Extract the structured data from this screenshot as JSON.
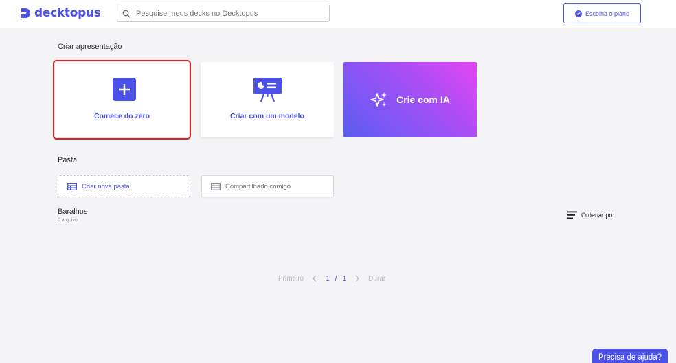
{
  "header": {
    "logo_text": "decktopus",
    "search_placeholder": "Pesquise meus decks no Decktopus",
    "plan_button_label": "Escolha o plano"
  },
  "create": {
    "title": "Criar apresentação",
    "cards": [
      {
        "label": "Comece do zero"
      },
      {
        "label": "Criar com um modelo"
      },
      {
        "label": "Crie com IA"
      }
    ]
  },
  "folders": {
    "title": "Pasta",
    "new_folder_label": "Criar nova pasta",
    "shared_label": "Compartilhado comigo"
  },
  "decks": {
    "title": "Baralhos",
    "count_label": "0 arquivo",
    "sort_label": "Ordenar por"
  },
  "pagination": {
    "first_label": "Primeiro",
    "current_page": "1",
    "separator": "/",
    "total_pages": "1",
    "last_label": "Durar"
  },
  "help_label": "Precisa de ajuda?",
  "colors": {
    "accent": "#4b52e5",
    "background": "#f4f4f7",
    "selection": "#d62828",
    "ai_gradient_start": "#5a5df2",
    "ai_gradient_end": "#e145f0"
  },
  "icons": [
    "logo-mark-icon",
    "search-icon",
    "check-circle-icon",
    "plus-icon",
    "presentation-board-icon",
    "sparkle-icon",
    "folder-list-icon",
    "sort-lines-icon",
    "chevron-left-icon",
    "chevron-right-icon"
  ]
}
